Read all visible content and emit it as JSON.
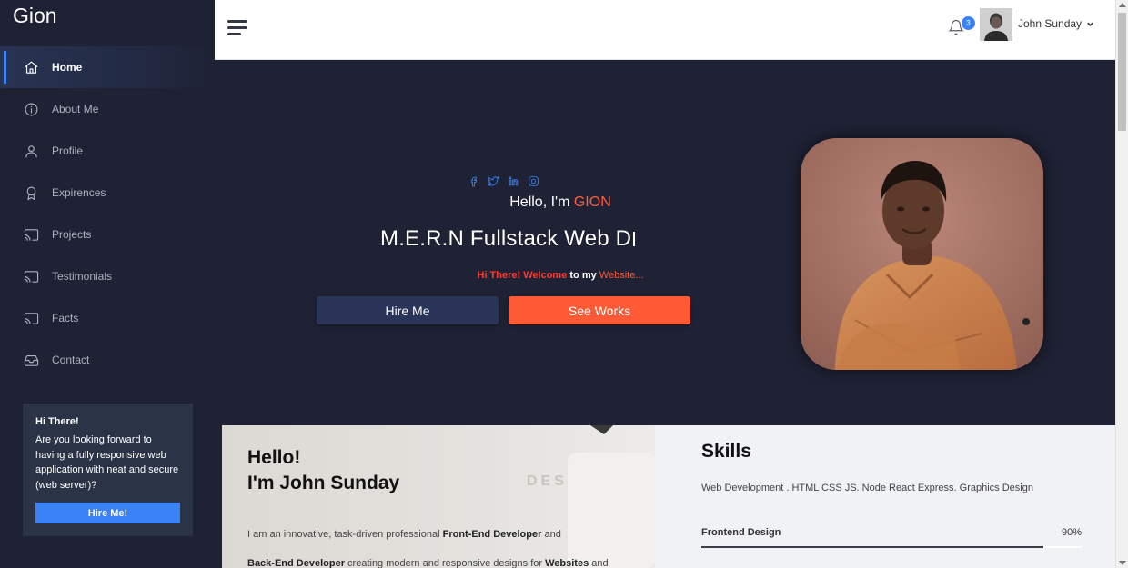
{
  "brand": "Gion",
  "sidebar": {
    "items": [
      {
        "label": "Home",
        "icon": "home-icon",
        "active": true
      },
      {
        "label": "About Me",
        "icon": "info-icon"
      },
      {
        "label": "Profile",
        "icon": "user-icon"
      },
      {
        "label": "Expirences",
        "icon": "award-icon"
      },
      {
        "label": "Projects",
        "icon": "cast-icon"
      },
      {
        "label": "Testimonials",
        "icon": "cast-icon"
      },
      {
        "label": "Facts",
        "icon": "cast-icon"
      },
      {
        "label": "Contact",
        "icon": "inbox-icon"
      }
    ],
    "promo": {
      "title": "Hi There!",
      "text": "Are you looking forward to having a fully responsive web application with neat and secure (web server)?",
      "button": "Hire Me!"
    }
  },
  "topbar": {
    "notification_count": "3",
    "user_name": "John Sunday"
  },
  "hero": {
    "greeting_prefix": "Hello, I'm ",
    "greeting_name": "GION",
    "typed_text": "M.E.R.N Fullstack Web D",
    "welcome_red": "Hi There! Welcome",
    "welcome_to": " to my ",
    "welcome_site": "Website...",
    "hire_button": "Hire Me",
    "works_button": "See Works"
  },
  "about": {
    "title_line1": "Hello!",
    "title_line2": "I'm John Sunday",
    "text_1": "I am an innovative, task-driven professional ",
    "text_bold_1": "Front-End Developer",
    "text_2": " and",
    "text_bold_2": "Back-End Developer",
    "text_3": " creating modern and responsive designs for ",
    "text_bold_3": "Websites",
    "text_4": " and"
  },
  "skills": {
    "title": "Skills",
    "subtitle": "Web Development . HTML CSS JS. Node React Express. Graphics Design",
    "items": [
      {
        "name": "Frontend Design",
        "percent": "90%",
        "level": 0.9
      }
    ]
  },
  "colors": {
    "accent_blue": "#3b82f6",
    "accent_orange": "#ff5a36",
    "dark_bg": "#1f2235"
  }
}
